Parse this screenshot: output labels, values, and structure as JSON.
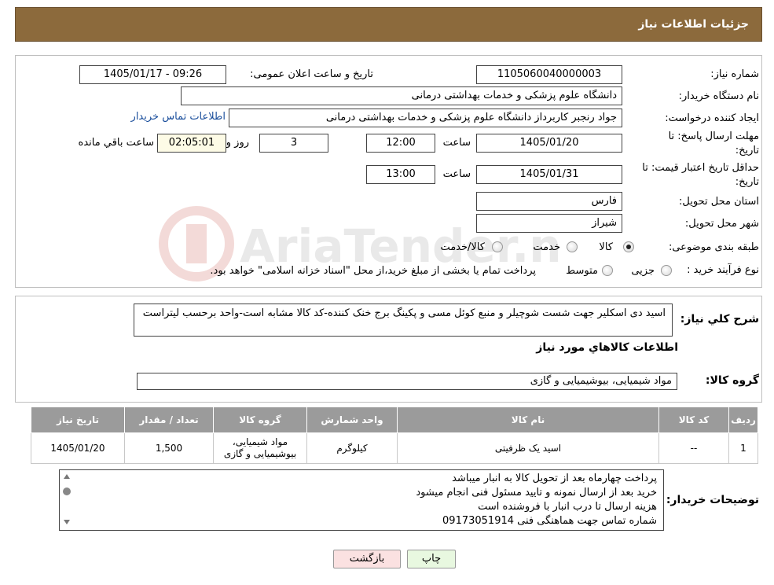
{
  "header": {
    "title": "جزئیات اطلاعات نیاز"
  },
  "watermark": {
    "text": "AriaTender.neT"
  },
  "form": {
    "need_number_label": "شماره نیاز:",
    "need_number": "1105060040000003",
    "announce_label": "تاریخ و ساعت اعلان عمومی:",
    "announce_value": "1405/01/17 - 09:26",
    "buyer_org_label": "نام دستگاه خریدار:",
    "buyer_org": "دانشگاه علوم پزشکی و خدمات بهداشتی درمانی",
    "creator_label": "ایجاد کننده درخواست:",
    "creator": "جواد رنجبر کاربرداز دانشگاه علوم پزشکی و خدمات بهداشتی درمانی",
    "contact_link": "اطلاعات تماس خریدار",
    "deadline_label_1": "مهلت ارسال پاسخ: تا",
    "deadline_label_2": "تاریخ:",
    "deadline_date": "1405/01/20",
    "time_label": "ساعت",
    "deadline_time": "12:00",
    "days_value": "3",
    "days_label": "روز و",
    "remaining_time": "02:05:01",
    "remaining_label": "ساعت باقي مانده",
    "validity_label_1": "حداقل تاریخ اعتبار قیمت: تا",
    "validity_label_2": "تاریخ:",
    "validity_date": "1405/01/31",
    "validity_time": "13:00",
    "province_label": "استان محل تحویل:",
    "province": "فارس",
    "city_label": "شهر محل تحویل:",
    "city": "شیراز",
    "category_label": "طبقه بندی موضوعی:",
    "category_options": [
      "کالا",
      "خدمت",
      "کالا/خدمت"
    ],
    "process_label": "نوع فرآیند خرید :",
    "process_options": [
      "جزیی",
      "متوسط"
    ],
    "process_note": "پرداخت تمام یا بخشی از مبلغ خرید،از محل \"اسناد خزانه اسلامی\" خواهد بود."
  },
  "description": {
    "label": "شرح کلي نياز:",
    "text": "اسید دی اسکلیر جهت شست شوچیلر و منبع کوئل مسی و پکینگ برج خنک کننده-کد کالا مشابه است-واحد برحسب لیتراست"
  },
  "items_section": {
    "title": "اطلاعات کالاهاي مورد نياز",
    "group_label": "گروه کالا:",
    "group_value": "مواد شیمیایی، بیوشیمیایی و  گازی"
  },
  "table": {
    "headers": [
      "رديف",
      "کد کالا",
      "نام کالا",
      "واحد شمارش",
      "گروه کالا",
      "تعداد / مقدار",
      "تاریخ نیاز"
    ],
    "rows": [
      {
        "row": "1",
        "code": "--",
        "name": "اسید یک ظرفیتی",
        "unit": "کیلوگرم",
        "group": "مواد شیمیایی، بیوشیمیایی و گازی",
        "qty": "1,500",
        "date": "1405/01/20"
      }
    ]
  },
  "buyer_notes": {
    "label": "توضیحات خریدار:",
    "lines": [
      "پرداخت چهارماه بعد از تحویل کالا به انبار میباشد",
      "خرید بعد از ارسال نمونه و تایید مسئول فنی انجام میشود",
      "هزینه ارسال تا درب انبار با فروشنده است",
      "شماره تماس جهت  هماهنگی فنی 09173051914"
    ]
  },
  "buttons": {
    "print": "چاپ",
    "back": "بازگشت"
  },
  "colors": {
    "header": "#8c6a3c",
    "table_header": "#9b9b9b",
    "print_btn": "#e8f8e0",
    "back_btn": "#fbe1e1"
  }
}
